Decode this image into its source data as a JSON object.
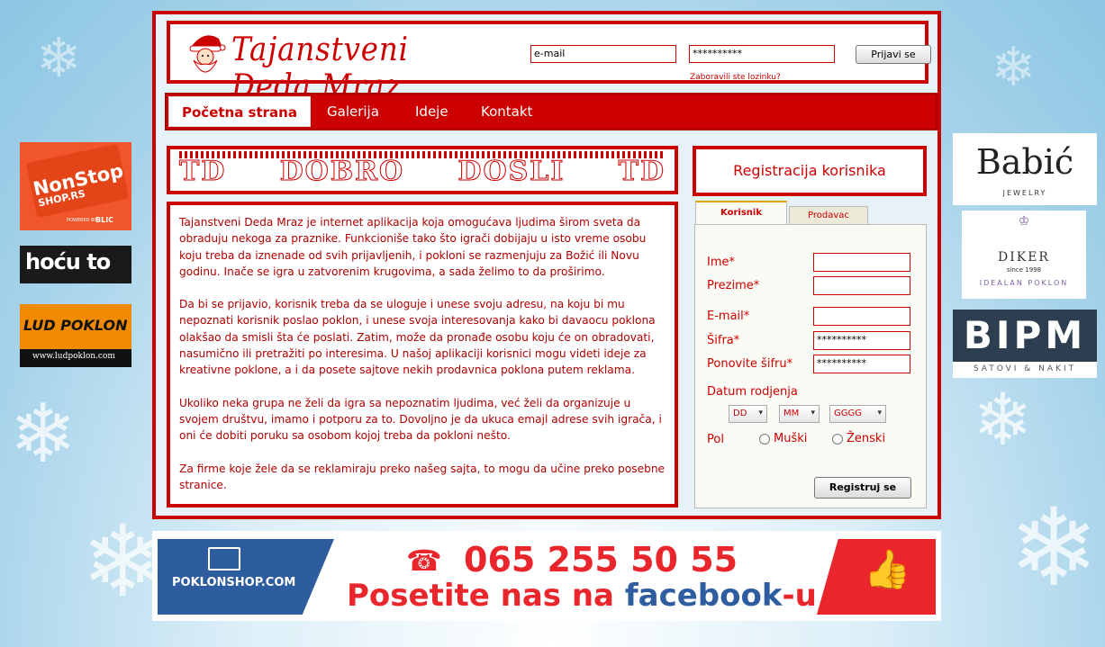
{
  "site": {
    "logo_text": "Tajanstveni Deda Mraz",
    "santa_icon": "santa-icon"
  },
  "login": {
    "email_value": "e-mail",
    "password_value": "**********",
    "forgot_label": "Zaboravili ste lozinku?",
    "login_button": "Prijavi se"
  },
  "nav": {
    "items": [
      {
        "label": "Početna strana",
        "active": true
      },
      {
        "label": "Galerija",
        "active": false
      },
      {
        "label": "Ideje",
        "active": false
      },
      {
        "label": "Kontakt",
        "active": false
      }
    ]
  },
  "welcome": {
    "text": "TD DOBRO DOSLI TD",
    "words": [
      "TD",
      "DOBRO",
      "DOSLI",
      "TD"
    ]
  },
  "content": {
    "paragraphs": [
      "Tajanstveni Deda Mraz je internet aplikacija koja omogućava ljudima širom sveta da obraduju nekoga za praznike. Funkcioniše tako što igrači dobijaju u isto vreme osobu koju treba da iznenade od svih prijavljenih, i pokloni se razmenjuju za Božić ili Novu godinu. Inače se igra u zatvorenim krugovima, a sada želimo to da proširimo.",
      "Da bi se prijavio, korisnik treba da se uloguje i unese svoju adresu, na koju bi mu nepoznati korisnik poslao poklon, i unese svoja interesovanja kako bi davaocu poklona olakšao da smisli šta će poslati. Zatim, može da pronađe osobu koju će on obradovati, nasumično ili pretražiti po interesima. U našoj aplikaciji korisnici mogu videti ideje za kreativne poklone, a i da posete sajtove nekih prodavnica poklona putem reklama.",
      "Ukoliko neka grupa ne želi da igra sa nepoznatim ljudima, već želi da organizuje u svojem društvu, imamo i potporu za to. Dovoljno je da ukuca emajl adrese svih igrača, i oni će dobiti poruku sa osobom kojoj treba da pokloni nešto.",
      "Za firme koje žele da se reklamiraju preko našeg sajta, to mogu da učine preko posebne stranice."
    ]
  },
  "registration": {
    "title": "Registracija korisnika",
    "tabs": [
      {
        "label": "Korisnik",
        "active": true
      },
      {
        "label": "Prodavac",
        "active": false
      }
    ],
    "fields": {
      "ime": {
        "label": "Ime*",
        "value": ""
      },
      "prezime": {
        "label": "Prezime*",
        "value": ""
      },
      "email": {
        "label": "E-mail*",
        "value": ""
      },
      "sifra": {
        "label": "Šifra*",
        "value": "**********"
      },
      "ponovite": {
        "label": "Ponovite šifru*",
        "value": "**********"
      }
    },
    "dob_label": "Datum rodjenja",
    "dob": {
      "day": "DD",
      "month": "MM",
      "year": "GGGG"
    },
    "pol_label": "Pol",
    "pol_options": [
      "Muški",
      "Ženski"
    ],
    "submit": "Registruj se"
  },
  "ads_left": [
    {
      "line1": "NonStop",
      "line2": "SHOP.RS",
      "line3": "POWERED BY",
      "line4": "BLIC"
    },
    {
      "text": "hoću to"
    },
    {
      "line1": "LUD POKLON",
      "line2": "www.ludpoklon.com"
    }
  ],
  "ads_right": [
    {
      "line1": "Babić",
      "line2": "JEWELRY"
    },
    {
      "line1": "DIKER",
      "line2": "since 1998",
      "line3": "IDEALAN POKLON"
    },
    {
      "line1": "BIPM",
      "line2": "SATOVI & NAKIT"
    }
  ],
  "banner": {
    "brand": "POKLONSHOP.COM",
    "phone": "065 255 50 55",
    "cta_prefix": "Posetite nas na ",
    "cta_brand": "facebook",
    "cta_suffix": "-u"
  },
  "colors": {
    "accent": "#cc0000",
    "banner_blue": "#2e5d9f",
    "banner_red": "#e8262b"
  }
}
